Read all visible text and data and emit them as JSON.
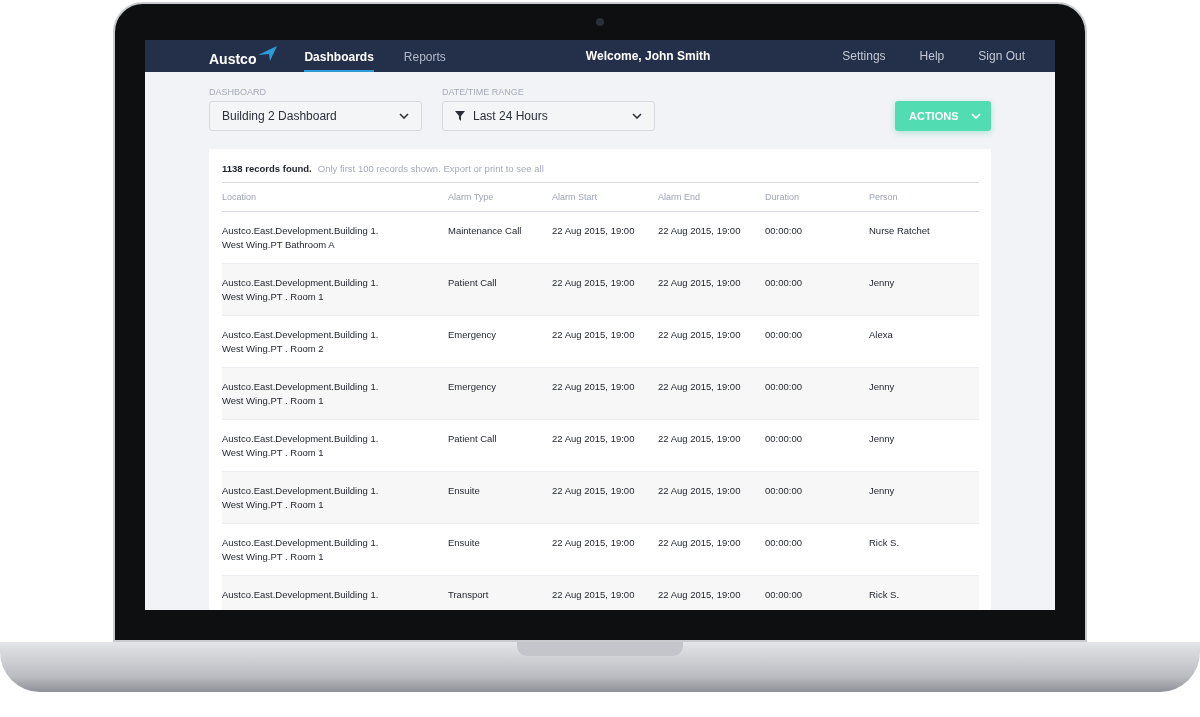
{
  "header": {
    "logo": "Austco",
    "nav": [
      {
        "label": "Dashboards",
        "selected": true
      },
      {
        "label": "Reports",
        "selected": false
      }
    ],
    "welcome": "Welcome, John Smith",
    "links": [
      "Settings",
      "Help",
      "Sign Out"
    ]
  },
  "filters": [
    {
      "label": "DASHBOARD",
      "value": "Building 2 Dashboard",
      "kind": "plain"
    },
    {
      "label": "DATE/TIME RANGE",
      "value": "Last 24 Hours",
      "kind": "filter"
    }
  ],
  "actions_button": "ACTIONS",
  "summary": {
    "count": "1138 records found.",
    "note": "Only first 100 records shown. Export or print to see all"
  },
  "table": {
    "columns": [
      "Location",
      "Alarm Type",
      "Alarm Start",
      "Alarm End",
      "Duration",
      "Person"
    ],
    "rows": [
      {
        "location": [
          "Austco.East.Development.Building 1.",
          "West Wing.PT Bathroom A"
        ],
        "alarm_type": "Maintenance Call",
        "start": "22 Aug 2015, 19:00",
        "end": "22 Aug 2015, 19:00",
        "duration": "00:00:00",
        "person": "Nurse Ratchet"
      },
      {
        "location": [
          "Austco.East.Development.Building 1.",
          "West Wing.PT . Room 1"
        ],
        "alarm_type": "Patient Call",
        "start": "22 Aug 2015, 19:00",
        "end": "22 Aug 2015, 19:00",
        "duration": "00:00:00",
        "person": "Jenny"
      },
      {
        "location": [
          "Austco.East.Development.Building 1.",
          "West Wing.PT . Room 2"
        ],
        "alarm_type": "Emergency",
        "start": "22 Aug 2015, 19:00",
        "end": "22 Aug 2015, 19:00",
        "duration": "00:00:00",
        "person": "Alexa"
      },
      {
        "location": [
          "Austco.East.Development.Building 1.",
          "West Wing.PT . Room 1"
        ],
        "alarm_type": "Emergency",
        "start": "22 Aug 2015, 19:00",
        "end": "22 Aug 2015, 19:00",
        "duration": "00:00:00",
        "person": "Jenny"
      },
      {
        "location": [
          "Austco.East.Development.Building 1.",
          "West Wing.PT . Room 1"
        ],
        "alarm_type": "Patient Call",
        "start": "22 Aug 2015, 19:00",
        "end": "22 Aug 2015, 19:00",
        "duration": "00:00:00",
        "person": "Jenny"
      },
      {
        "location": [
          "Austco.East.Development.Building 1.",
          "West Wing.PT . Room 1"
        ],
        "alarm_type": "Ensuite",
        "start": "22 Aug 2015, 19:00",
        "end": "22 Aug 2015, 19:00",
        "duration": "00:00:00",
        "person": "Jenny"
      },
      {
        "location": [
          "Austco.East.Development.Building 1.",
          "West Wing.PT . Room 1"
        ],
        "alarm_type": "Ensuite",
        "start": "22 Aug 2015, 19:00",
        "end": "22 Aug 2015, 19:00",
        "duration": "00:00:00",
        "person": "Rick S."
      },
      {
        "location": [
          "Austco.East.Development.Building 1."
        ],
        "alarm_type": "Transport",
        "start": "22 Aug 2015, 19:00",
        "end": "22 Aug 2015, 19:00",
        "duration": "00:00:00",
        "person": "Rick S."
      }
    ]
  }
}
